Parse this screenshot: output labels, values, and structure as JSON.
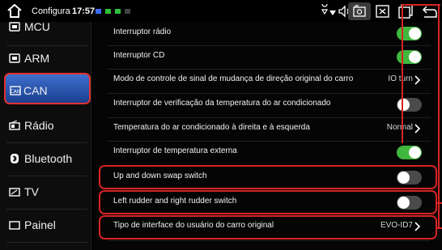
{
  "statusbar": {
    "title": "Configura",
    "time": "17:57",
    "dot_colors": [
      "#3b6cff",
      "#2fbf3a",
      "#2fbf3a",
      "#555555"
    ],
    "icons": [
      "home-icon",
      "location-icon",
      "wifi-icon",
      "volume-icon",
      "screenshot-icon",
      "close-box-icon",
      "window-icon",
      "back-icon"
    ]
  },
  "sidebar": {
    "items": [
      {
        "label": "MCU",
        "icon": "chip-icon"
      },
      {
        "label": "ARM",
        "icon": "chip-icon"
      },
      {
        "label": "CAN",
        "icon": "can-icon",
        "active": true
      },
      {
        "label": "Rádio",
        "icon": "radio-icon"
      },
      {
        "label": "Bluetooth",
        "icon": "bluetooth-icon"
      },
      {
        "label": "TV",
        "icon": "tv-icon"
      },
      {
        "label": "Painel",
        "icon": "panel-icon"
      }
    ]
  },
  "settings": {
    "rows": [
      {
        "label": "Interruptor rádio",
        "kind": "toggle",
        "on": true
      },
      {
        "label": "Interruptor CD",
        "kind": "toggle",
        "on": true
      },
      {
        "label": "Modo de controle de sinal de mudança de direção original do carro",
        "kind": "select",
        "value": "IO turn"
      },
      {
        "label": "Interruptor de verificação da temperatura do ar condicionado",
        "kind": "toggle",
        "on": false
      },
      {
        "label": "Temperatura do ar condicionado à direita e à esquerda",
        "kind": "select",
        "value": "Normal"
      },
      {
        "label": "Interruptor de temperatura externa",
        "kind": "toggle",
        "on": true
      },
      {
        "label": "Up and down swap switch",
        "kind": "toggle",
        "on": false
      },
      {
        "label": "Left rudder and right rudder switch",
        "kind": "toggle",
        "on": false
      },
      {
        "label": "Tipo de interface do usuário do carro original",
        "kind": "select",
        "value": "EVO-ID7"
      }
    ]
  },
  "colors": {
    "accent": "#3fb83d",
    "highlight": "#d82424",
    "active_tab": "#2f5bbf"
  }
}
